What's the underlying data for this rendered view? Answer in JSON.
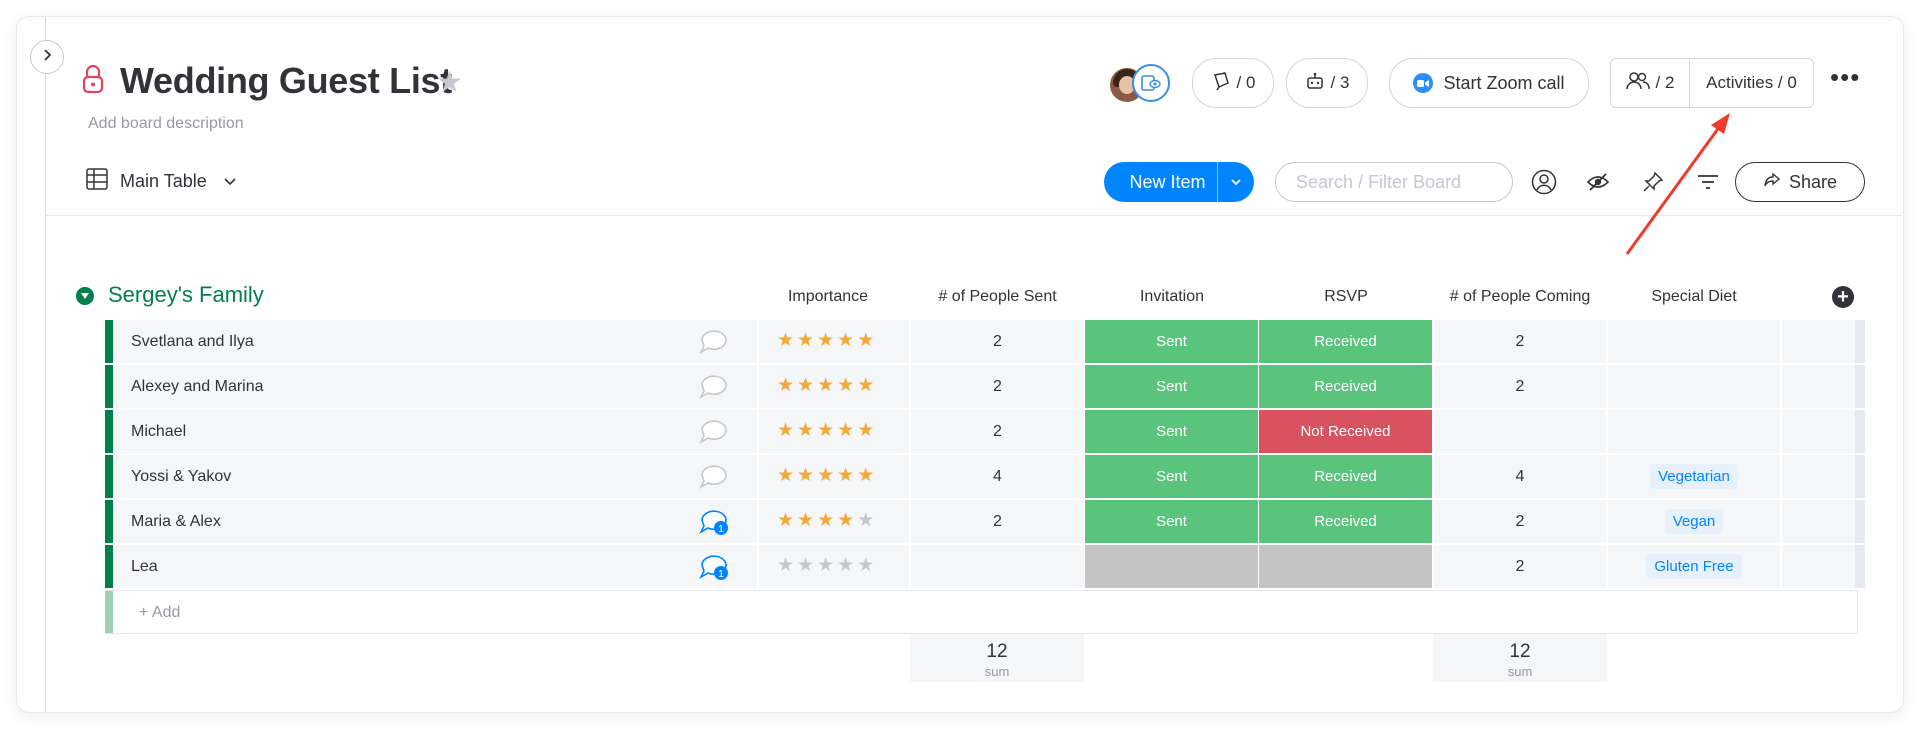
{
  "board": {
    "title": "Wedding Guest List",
    "description": "Add board description"
  },
  "header": {
    "updates_count": "/ 0",
    "automations_count": "/ 3",
    "zoom_label": "Start Zoom call",
    "people_count": "/ 2",
    "activities_label": "Activities / 0",
    "more_label": "•••"
  },
  "view": {
    "name": "Main Table"
  },
  "toolbar": {
    "new_item_label": "New Item",
    "search_placeholder": "Search / Filter Board",
    "share_label": "Share"
  },
  "group": {
    "title": "Sergey's Family",
    "color": "#037f4c",
    "columns": [
      "Importance",
      "# of People Sent",
      "Invitation",
      "RSVP",
      "# of People Coming",
      "Special Diet"
    ],
    "add_row_label": "+ Add",
    "rows": [
      {
        "name": "Svetlana and Ilya",
        "updates": "",
        "importance": 5,
        "sent": "2",
        "invitation": "Sent",
        "rsvp": "Received",
        "coming": "2",
        "diet": ""
      },
      {
        "name": "Alexey and Marina",
        "updates": "",
        "importance": 5,
        "sent": "2",
        "invitation": "Sent",
        "rsvp": "Received",
        "coming": "2",
        "diet": ""
      },
      {
        "name": "Michael",
        "updates": "",
        "importance": 5,
        "sent": "2",
        "invitation": "Sent",
        "rsvp": "Not Received",
        "coming": "",
        "diet": ""
      },
      {
        "name": "Yossi & Yakov",
        "updates": "",
        "importance": 5,
        "sent": "4",
        "invitation": "Sent",
        "rsvp": "Received",
        "coming": "4",
        "diet": "Vegetarian"
      },
      {
        "name": "Maria & Alex",
        "updates": "1",
        "importance": 4,
        "sent": "2",
        "invitation": "Sent",
        "rsvp": "Received",
        "coming": "2",
        "diet": "Vegan"
      },
      {
        "name": "Lea",
        "updates": "1",
        "importance": 0,
        "sent": "",
        "invitation": "",
        "rsvp": "",
        "coming": "2",
        "diet": "Gluten Free"
      }
    ],
    "summary": {
      "sent_sum": "12",
      "sent_label": "sum",
      "coming_sum": "12",
      "coming_label": "sum"
    }
  },
  "status_colors": {
    "Sent": "#5ac47d",
    "Received": "#5ac47d",
    "Not Received": "#d8525f",
    "": "#c4c4c4"
  },
  "icons": {
    "lock": "lock-icon",
    "star": "star-icon",
    "updates": "updates-icon",
    "automations": "robot-icon",
    "zoom": "zoom-icon",
    "people": "people-icon",
    "table": "table-icon",
    "person": "person-icon",
    "eye": "eye-off-icon",
    "pin": "pin-icon",
    "filter": "filter-icon",
    "share": "share-icon"
  },
  "annotation": {
    "arrow_color": "#ee3b2b"
  }
}
